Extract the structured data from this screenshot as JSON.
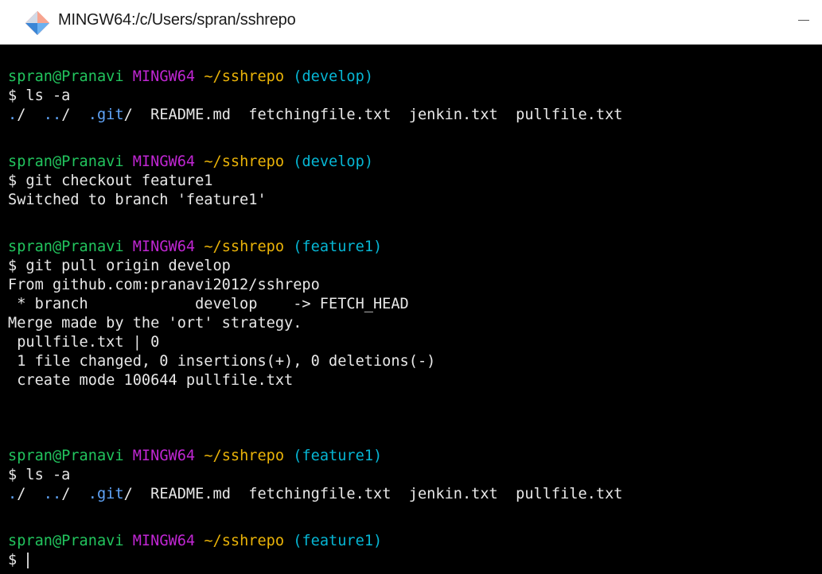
{
  "window": {
    "title": "MINGW64:/c/Users/spran/sshrepo"
  },
  "colors": {
    "user": "#22c55e",
    "host": "#c026d3",
    "path": "#eab308",
    "branch": "#06b6d4",
    "dir": "#60a5fa",
    "text": "#e8e8e8"
  },
  "prompts": [
    {
      "user": "spran@Pranavi",
      "host": "MINGW64",
      "path": "~/sshrepo",
      "branch": "(develop)"
    },
    {
      "user": "spran@Pranavi",
      "host": "MINGW64",
      "path": "~/sshrepo",
      "branch": "(develop)"
    },
    {
      "user": "spran@Pranavi",
      "host": "MINGW64",
      "path": "~/sshrepo",
      "branch": "(feature1)"
    },
    {
      "user": "spran@Pranavi",
      "host": "MINGW64",
      "path": "~/sshrepo",
      "branch": "(feature1)"
    },
    {
      "user": "spran@Pranavi",
      "host": "MINGW64",
      "path": "~/sshrepo",
      "branch": "(feature1)"
    }
  ],
  "commands": [
    "$ ls -a",
    "$ git checkout feature1",
    "$ git pull origin develop",
    "$ ls -a",
    "$"
  ],
  "listing1": [
    ".",
    "/  ",
    "..",
    "/  ",
    ".git",
    "/  ",
    "README.md  fetchingfile.txt  jenkin.txt  pullfile.txt"
  ],
  "output_checkout": "Switched to branch 'feature1'",
  "output_pull": [
    "From github.com:pranavi2012/sshrepo",
    " * branch            develop    -> FETCH_HEAD",
    "Merge made by the 'ort' strategy.",
    " pullfile.txt | 0",
    " 1 file changed, 0 insertions(+), 0 deletions(-)",
    " create mode 100644 pullfile.txt"
  ],
  "listing2": [
    ".",
    "/  ",
    "..",
    "/  ",
    ".git",
    "/  ",
    "README.md  fetchingfile.txt  jenkin.txt  pullfile.txt"
  ]
}
